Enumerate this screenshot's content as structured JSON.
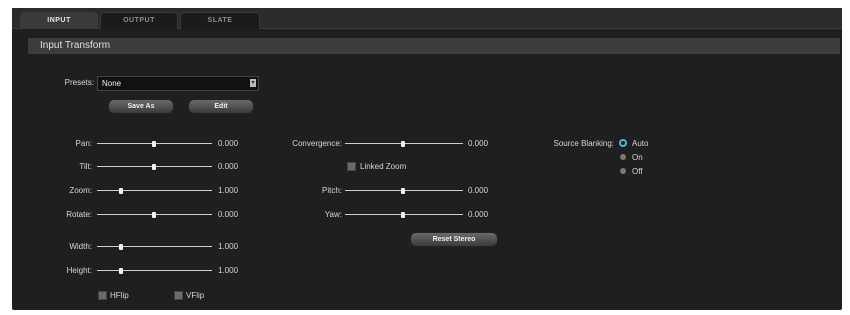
{
  "tabs": [
    {
      "label": "INPUT",
      "active": true
    },
    {
      "label": "OUTPUT",
      "active": false
    },
    {
      "label": "SLATE",
      "active": false
    }
  ],
  "section_title": "Input Transform",
  "presets": {
    "label": "Presets:",
    "value": "None",
    "save_as": "Save As",
    "edit": "Edit"
  },
  "left_sliders": [
    {
      "label": "Pan:",
      "value": "0.000",
      "pos": 0.5
    },
    {
      "label": "Tilt:",
      "value": "0.000",
      "pos": 0.5
    },
    {
      "label": "Zoom:",
      "value": "1.000",
      "pos": 0.2
    },
    {
      "label": "Rotate:",
      "value": "0.000",
      "pos": 0.5
    },
    {
      "label": "Width:",
      "value": "1.000",
      "pos": 0.2
    },
    {
      "label": "Height:",
      "value": "1.000",
      "pos": 0.2
    }
  ],
  "flips": {
    "hflip": "HFlip",
    "vflip": "VFlip"
  },
  "stereo": {
    "convergence": {
      "label": "Convergence:",
      "value": "0.000",
      "pos": 0.5
    },
    "linked_zoom": "Linked Zoom",
    "pitch": {
      "label": "Pitch:",
      "value": "0.000",
      "pos": 0.5
    },
    "yaw": {
      "label": "Yaw:",
      "value": "0.000",
      "pos": 0.5
    },
    "reset": "Reset Stereo"
  },
  "source_blanking": {
    "label": "Source Blanking:",
    "options": [
      "Auto",
      "On",
      "Off"
    ],
    "selected": "Auto"
  },
  "colors": {
    "accent": "#4ab7d6"
  }
}
